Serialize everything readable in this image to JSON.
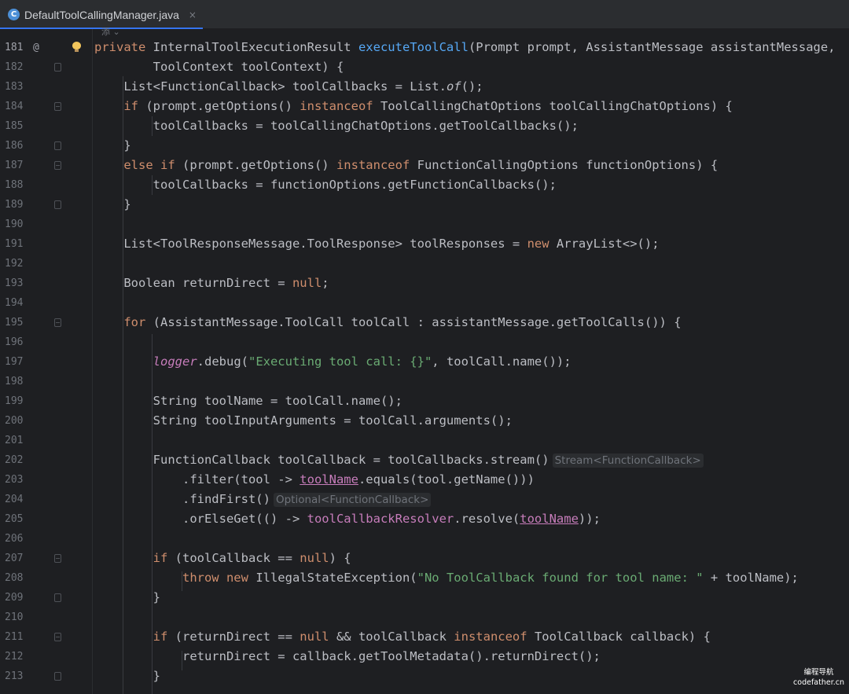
{
  "tab": {
    "icon_letter": "C",
    "label": "DefaultToolCallingManager.java",
    "close_glyph": "×"
  },
  "hint_above": "添 ⌄",
  "gutter": {
    "line_numbers": [
      "181",
      "182",
      "183",
      "184",
      "185",
      "186",
      "187",
      "188",
      "189",
      "190",
      "191",
      "192",
      "193",
      "194",
      "195",
      "196",
      "197",
      "198",
      "199",
      "200",
      "201",
      "202",
      "203",
      "204",
      "205",
      "206",
      "207",
      "208",
      "209",
      "210",
      "211",
      "212",
      "213"
    ],
    "at_symbol": "@"
  },
  "code": {
    "l181": {
      "kw": "private ",
      "t1": "InternalToolExecutionResult ",
      "fn": "executeToolCall",
      "t2": "(Prompt prompt, AssistantMessage assistantMessage,"
    },
    "l182": "        ToolContext toolContext) {",
    "l183": {
      "t1": "    List<FunctionCallback> toolCallbacks = List.",
      "it": "of",
      "t2": "();"
    },
    "l184": {
      "kw": "    if ",
      "t1": "(prompt.getOptions() ",
      "kw2": "instanceof ",
      "t2": "ToolCallingChatOptions toolCallingChatOptions) {"
    },
    "l185": "        toolCallbacks = toolCallingChatOptions.getToolCallbacks();",
    "l186": "    }",
    "l187": {
      "kw": "    else if ",
      "t1": "(prompt.getOptions() ",
      "kw2": "instanceof ",
      "t2": "FunctionCallingOptions functionOptions) {"
    },
    "l188": "        toolCallbacks = functionOptions.getFunctionCallbacks();",
    "l189": "    }",
    "l191": {
      "t1": "    List<ToolResponseMessage.ToolResponse> toolResponses = ",
      "kw": "new ",
      "t2": "ArrayList<>();"
    },
    "l193": {
      "t1": "    Boolean returnDirect = ",
      "kw": "null",
      "t2": ";"
    },
    "l195": {
      "kw": "    for ",
      "t1": "(AssistantMessage.ToolCall toolCall : assistantMessage.getToolCalls()) {"
    },
    "l197": {
      "log": "logger",
      "t1": ".debug(",
      "str": "\"Executing tool call: {}\"",
      "t2": ", toolCall.name());"
    },
    "l199": "        String toolName = toolCall.name();",
    "l200": "        String toolInputArguments = toolCall.arguments();",
    "l202": {
      "t1": "        FunctionCallback toolCallback = toolCallbacks.stream()",
      "hint": "Stream<FunctionCallback>"
    },
    "l203": {
      "t1": "            .filter(tool -> ",
      "ul": "toolName",
      "t2": ".equals(tool.getName()))"
    },
    "l204": {
      "t1": "            .findFirst()",
      "hint": "Optional<FunctionCallback>"
    },
    "l205": {
      "t1": "            .orElseGet(() -> ",
      "inst": "toolCallbackResolver",
      "t2": ".resolve(",
      "ul": "toolName",
      "t3": "));"
    },
    "l207": {
      "kw": "        if ",
      "t1": "(toolCallback == ",
      "kw2": "null",
      "t2": ") {"
    },
    "l208": {
      "kw": "            throw new ",
      "t1": "IllegalStateException(",
      "str": "\"No ToolCallback found for tool name: \"",
      "t2": " + toolName);"
    },
    "l209": "        }",
    "l211": {
      "kw": "        if ",
      "t1": "(returnDirect == ",
      "kw2": "null ",
      "t2": "&& toolCallback ",
      "kw3": "instanceof ",
      "t3": "ToolCallback callback) {"
    },
    "l212": "            returnDirect = callback.getToolMetadata().returnDirect();",
    "l213": "        }"
  },
  "watermark": {
    "line1": "编程导航",
    "line2": "codefather.cn"
  },
  "colors": {
    "keyword": "#cf8e6d",
    "method": "#56a8f5",
    "string": "#6aab73",
    "field": "#c77dbb",
    "text": "#bcbec4",
    "background": "#1e1f22"
  }
}
